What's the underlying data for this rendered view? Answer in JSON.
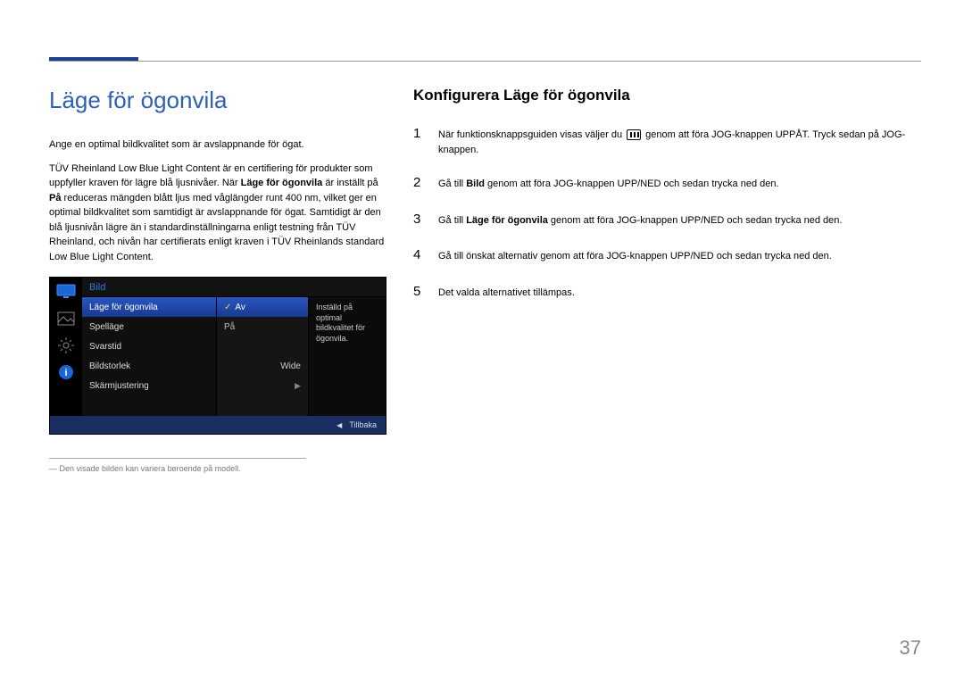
{
  "page_number": "37",
  "left": {
    "title": "Läge för ögonvila",
    "intro1": "Ange en optimal bildkvalitet som är avslappnande för ögat.",
    "intro2_pre": "TÜV Rheinland Low Blue Light Content är en certifiering för produkter som uppfyller kraven för lägre blå ljusnivåer. När ",
    "intro2_bold1": "Läge för ögonvila",
    "intro2_mid": " är inställt på ",
    "intro2_bold2": "På",
    "intro2_post": " reduceras mängden blått ljus med våglängder runt 400 nm, vilket ger en optimal bildkvalitet som samtidigt är avslappnande för ögat. Samtidigt är den blå ljusnivån lägre än i standardinställningarna enligt testning från TÜV Rheinland, och nivån har certifierats enligt kraven i TÜV Rheinlands standard Low Blue Light Content.",
    "footnote_dash": "―",
    "footnote": "Den visade bilden kan variera beroende på modell."
  },
  "osd": {
    "header": "Bild",
    "desc": "Inställd på optimal bildkvalitet för ögonvila.",
    "menu": [
      "Läge för ögonvila",
      "Spelläge",
      "Svarstid",
      "Bildstorlek",
      "Skärmjustering"
    ],
    "val_av": "Av",
    "val_pa": "På",
    "val_wide": "Wide",
    "footer_back": "Tillbaka"
  },
  "right": {
    "title": "Konfigurera Läge för ögonvila",
    "steps": {
      "s1_pre": "När funktionsknappsguiden visas väljer du ",
      "s1_post": " genom att föra JOG-knappen UPPÅT. Tryck sedan på JOG-knappen.",
      "s2_pre": "Gå till ",
      "s2_bold": "Bild",
      "s2_post": " genom att föra JOG-knappen UPP/NED och sedan trycka ned den.",
      "s3_pre": "Gå till ",
      "s3_bold": "Läge för ögonvila",
      "s3_post": " genom att föra JOG-knappen UPP/NED och sedan trycka ned den.",
      "s4": "Gå till önskat alternativ genom att föra JOG-knappen UPP/NED och sedan trycka ned den.",
      "s5": "Det valda alternativet tillämpas."
    }
  }
}
